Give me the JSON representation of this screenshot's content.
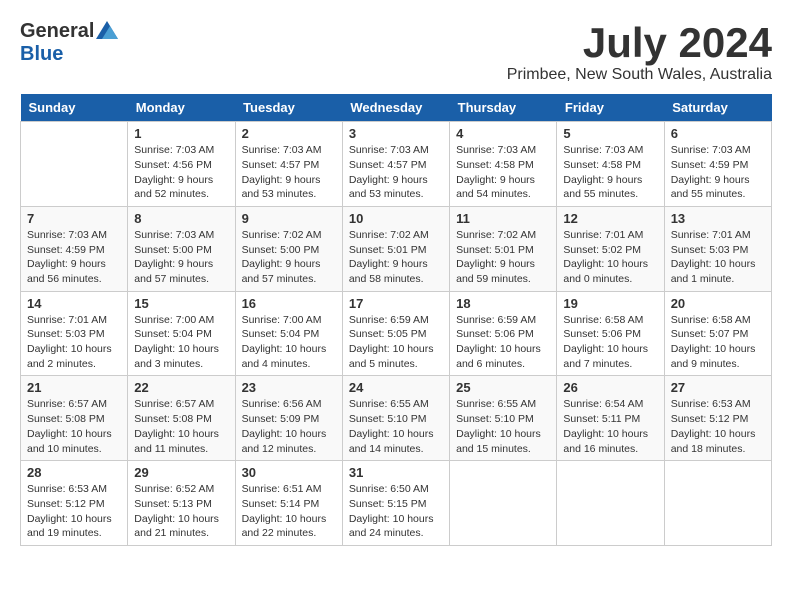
{
  "logo": {
    "general": "General",
    "blue": "Blue"
  },
  "title": {
    "month_year": "July 2024",
    "location": "Primbee, New South Wales, Australia"
  },
  "days_of_week": [
    "Sunday",
    "Monday",
    "Tuesday",
    "Wednesday",
    "Thursday",
    "Friday",
    "Saturday"
  ],
  "weeks": [
    [
      {
        "day": "",
        "info": ""
      },
      {
        "day": "1",
        "info": "Sunrise: 7:03 AM\nSunset: 4:56 PM\nDaylight: 9 hours\nand 52 minutes."
      },
      {
        "day": "2",
        "info": "Sunrise: 7:03 AM\nSunset: 4:57 PM\nDaylight: 9 hours\nand 53 minutes."
      },
      {
        "day": "3",
        "info": "Sunrise: 7:03 AM\nSunset: 4:57 PM\nDaylight: 9 hours\nand 53 minutes."
      },
      {
        "day": "4",
        "info": "Sunrise: 7:03 AM\nSunset: 4:58 PM\nDaylight: 9 hours\nand 54 minutes."
      },
      {
        "day": "5",
        "info": "Sunrise: 7:03 AM\nSunset: 4:58 PM\nDaylight: 9 hours\nand 55 minutes."
      },
      {
        "day": "6",
        "info": "Sunrise: 7:03 AM\nSunset: 4:59 PM\nDaylight: 9 hours\nand 55 minutes."
      }
    ],
    [
      {
        "day": "7",
        "info": "Sunrise: 7:03 AM\nSunset: 4:59 PM\nDaylight: 9 hours\nand 56 minutes."
      },
      {
        "day": "8",
        "info": "Sunrise: 7:03 AM\nSunset: 5:00 PM\nDaylight: 9 hours\nand 57 minutes."
      },
      {
        "day": "9",
        "info": "Sunrise: 7:02 AM\nSunset: 5:00 PM\nDaylight: 9 hours\nand 57 minutes."
      },
      {
        "day": "10",
        "info": "Sunrise: 7:02 AM\nSunset: 5:01 PM\nDaylight: 9 hours\nand 58 minutes."
      },
      {
        "day": "11",
        "info": "Sunrise: 7:02 AM\nSunset: 5:01 PM\nDaylight: 9 hours\nand 59 minutes."
      },
      {
        "day": "12",
        "info": "Sunrise: 7:01 AM\nSunset: 5:02 PM\nDaylight: 10 hours\nand 0 minutes."
      },
      {
        "day": "13",
        "info": "Sunrise: 7:01 AM\nSunset: 5:03 PM\nDaylight: 10 hours\nand 1 minute."
      }
    ],
    [
      {
        "day": "14",
        "info": "Sunrise: 7:01 AM\nSunset: 5:03 PM\nDaylight: 10 hours\nand 2 minutes."
      },
      {
        "day": "15",
        "info": "Sunrise: 7:00 AM\nSunset: 5:04 PM\nDaylight: 10 hours\nand 3 minutes."
      },
      {
        "day": "16",
        "info": "Sunrise: 7:00 AM\nSunset: 5:04 PM\nDaylight: 10 hours\nand 4 minutes."
      },
      {
        "day": "17",
        "info": "Sunrise: 6:59 AM\nSunset: 5:05 PM\nDaylight: 10 hours\nand 5 minutes."
      },
      {
        "day": "18",
        "info": "Sunrise: 6:59 AM\nSunset: 5:06 PM\nDaylight: 10 hours\nand 6 minutes."
      },
      {
        "day": "19",
        "info": "Sunrise: 6:58 AM\nSunset: 5:06 PM\nDaylight: 10 hours\nand 7 minutes."
      },
      {
        "day": "20",
        "info": "Sunrise: 6:58 AM\nSunset: 5:07 PM\nDaylight: 10 hours\nand 9 minutes."
      }
    ],
    [
      {
        "day": "21",
        "info": "Sunrise: 6:57 AM\nSunset: 5:08 PM\nDaylight: 10 hours\nand 10 minutes."
      },
      {
        "day": "22",
        "info": "Sunrise: 6:57 AM\nSunset: 5:08 PM\nDaylight: 10 hours\nand 11 minutes."
      },
      {
        "day": "23",
        "info": "Sunrise: 6:56 AM\nSunset: 5:09 PM\nDaylight: 10 hours\nand 12 minutes."
      },
      {
        "day": "24",
        "info": "Sunrise: 6:55 AM\nSunset: 5:10 PM\nDaylight: 10 hours\nand 14 minutes."
      },
      {
        "day": "25",
        "info": "Sunrise: 6:55 AM\nSunset: 5:10 PM\nDaylight: 10 hours\nand 15 minutes."
      },
      {
        "day": "26",
        "info": "Sunrise: 6:54 AM\nSunset: 5:11 PM\nDaylight: 10 hours\nand 16 minutes."
      },
      {
        "day": "27",
        "info": "Sunrise: 6:53 AM\nSunset: 5:12 PM\nDaylight: 10 hours\nand 18 minutes."
      }
    ],
    [
      {
        "day": "28",
        "info": "Sunrise: 6:53 AM\nSunset: 5:12 PM\nDaylight: 10 hours\nand 19 minutes."
      },
      {
        "day": "29",
        "info": "Sunrise: 6:52 AM\nSunset: 5:13 PM\nDaylight: 10 hours\nand 21 minutes."
      },
      {
        "day": "30",
        "info": "Sunrise: 6:51 AM\nSunset: 5:14 PM\nDaylight: 10 hours\nand 22 minutes."
      },
      {
        "day": "31",
        "info": "Sunrise: 6:50 AM\nSunset: 5:15 PM\nDaylight: 10 hours\nand 24 minutes."
      },
      {
        "day": "",
        "info": ""
      },
      {
        "day": "",
        "info": ""
      },
      {
        "day": "",
        "info": ""
      }
    ]
  ]
}
